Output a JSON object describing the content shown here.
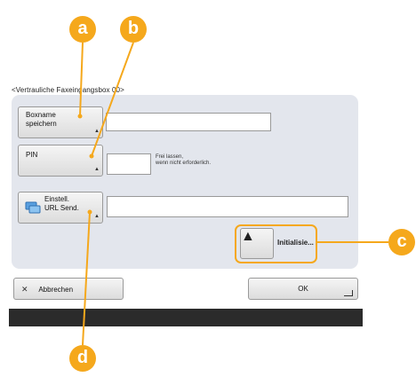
{
  "screen": {
    "title": "<Vertrauliche Faxeingangsbox 00>"
  },
  "form": {
    "boxname_button_label": "Boxname\nspeichern",
    "boxname_value": "",
    "pin_button_label": "PIN",
    "pin_value": "",
    "pin_note": "Frei lassen,\nwenn nicht erforderlich.",
    "url_button_label": "Einstell.\nURL Send.",
    "url_value": "",
    "init_button_label": "Initialisie..."
  },
  "footer": {
    "cancel_label": "Abbrechen",
    "ok_label": "OK"
  },
  "callouts": {
    "a": "a",
    "b": "b",
    "c": "c",
    "d": "d"
  },
  "colors": {
    "callout": "#f5a81c",
    "panel": "#e3e6ed",
    "bottom_bar": "#2b2b2b"
  }
}
